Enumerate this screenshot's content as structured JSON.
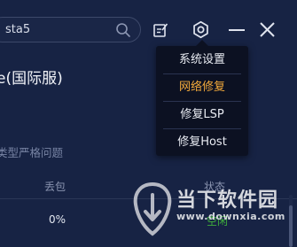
{
  "search": {
    "value": "sta5"
  },
  "toolbar": {
    "icons": [
      "search-icon",
      "notes-icon",
      "gear-icon",
      "minimize-icon",
      "close-icon"
    ]
  },
  "main": {
    "title": "e(国际服)",
    "note": "类型严格问题"
  },
  "table": {
    "headers": {
      "loss": "丢包",
      "status": "状态"
    },
    "row": {
      "loss": "0%",
      "status": "空闲"
    }
  },
  "menu": {
    "items": [
      {
        "label": "系统设置"
      },
      {
        "label": "网络修复",
        "active": true
      },
      {
        "label": "修复LSP"
      },
      {
        "label": "修复Host"
      }
    ]
  },
  "watermark": {
    "name": "当下软件园",
    "url": "www.downxia.com"
  },
  "colors": {
    "background": "#172344",
    "menu_background": "#0c1122",
    "active_item": "#f2a93b",
    "status_idle": "#3fae3b"
  }
}
